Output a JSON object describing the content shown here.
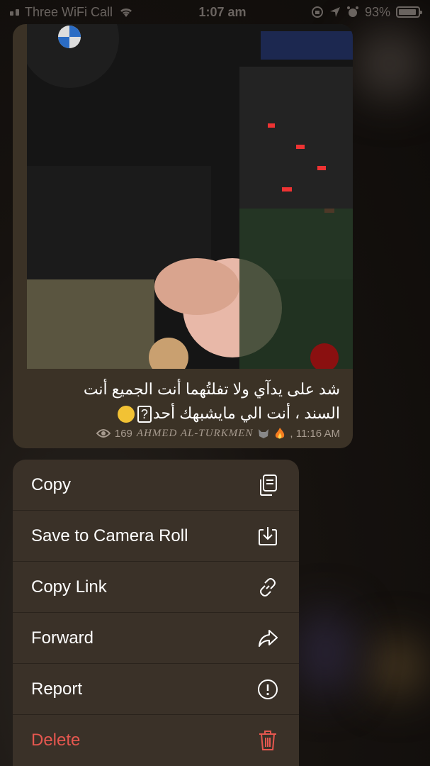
{
  "status_bar": {
    "carrier": "Three WiFi Call",
    "time": "1:07 am",
    "battery": "93%",
    "battery_level": 0.93
  },
  "message": {
    "caption_line1": "شد على يدآي ولا تفلتُهما أنت الجميع أنت",
    "caption_line2_text": "السند ، أنت الي مايشبهك أحد",
    "caption_box": "?",
    "views": "169",
    "author": "AHMED AL-TURKMEN",
    "time": ", 11:16 AM"
  },
  "menu": {
    "items": [
      {
        "label": "Copy",
        "icon": "copy-icon"
      },
      {
        "label": "Save to Camera Roll",
        "icon": "download-icon"
      },
      {
        "label": "Copy Link",
        "icon": "link-icon"
      },
      {
        "label": "Forward",
        "icon": "forward-icon"
      },
      {
        "label": "Report",
        "icon": "report-icon"
      },
      {
        "label": "Delete",
        "icon": "trash-icon"
      }
    ]
  },
  "colors": {
    "menu_bg": "#3a3128",
    "bubble_bg": "#3b3226",
    "danger": "#e5574f"
  }
}
